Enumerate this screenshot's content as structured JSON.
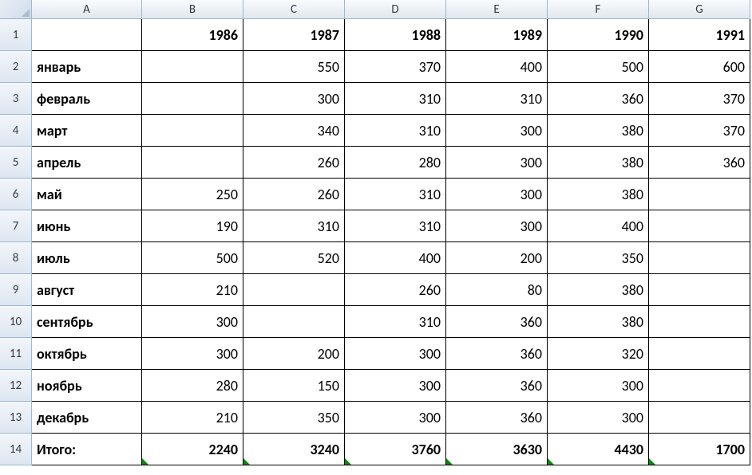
{
  "columns": [
    "A",
    "B",
    "C",
    "D",
    "E",
    "F",
    "G"
  ],
  "rowNumbers": [
    "1",
    "2",
    "3",
    "4",
    "5",
    "6",
    "7",
    "8",
    "9",
    "10",
    "11",
    "12",
    "13",
    "14"
  ],
  "headerRow": {
    "A": "",
    "B": "1986",
    "C": "1987",
    "D": "1988",
    "E": "1989",
    "F": "1990",
    "G": "1991"
  },
  "rows": [
    {
      "label": "январь",
      "B": "",
      "C": "550",
      "D": "370",
      "E": "400",
      "F": "500",
      "G": "600"
    },
    {
      "label": "февраль",
      "B": "",
      "C": "300",
      "D": "310",
      "E": "310",
      "F": "360",
      "G": "370"
    },
    {
      "label": "март",
      "B": "",
      "C": "340",
      "D": "310",
      "E": "300",
      "F": "380",
      "G": "370"
    },
    {
      "label": "апрель",
      "B": "",
      "C": "260",
      "D": "280",
      "E": "300",
      "F": "380",
      "G": "360"
    },
    {
      "label": "май",
      "B": "250",
      "C": "260",
      "D": "310",
      "E": "300",
      "F": "380",
      "G": ""
    },
    {
      "label": "июнь",
      "B": "190",
      "C": "310",
      "D": "310",
      "E": "300",
      "F": "400",
      "G": ""
    },
    {
      "label": "июль",
      "B": "500",
      "C": "520",
      "D": "400",
      "E": "200",
      "F": "350",
      "G": ""
    },
    {
      "label": "август",
      "B": "210",
      "C": "",
      "D": "260",
      "E": "80",
      "F": "380",
      "G": ""
    },
    {
      "label": "сентябрь",
      "B": "300",
      "C": "",
      "D": "310",
      "E": "360",
      "F": "380",
      "G": ""
    },
    {
      "label": "октябрь",
      "B": "300",
      "C": "200",
      "D": "300",
      "E": "360",
      "F": "320",
      "G": ""
    },
    {
      "label": "ноябрь",
      "B": "280",
      "C": "150",
      "D": "300",
      "E": "360",
      "F": "300",
      "G": ""
    },
    {
      "label": "декабрь",
      "B": "210",
      "C": "350",
      "D": "300",
      "E": "360",
      "F": "300",
      "G": ""
    }
  ],
  "totalRow": {
    "label": "Итого:",
    "B": "2240",
    "C": "3240",
    "D": "3760",
    "E": "3630",
    "F": "4430",
    "G": "1700"
  }
}
